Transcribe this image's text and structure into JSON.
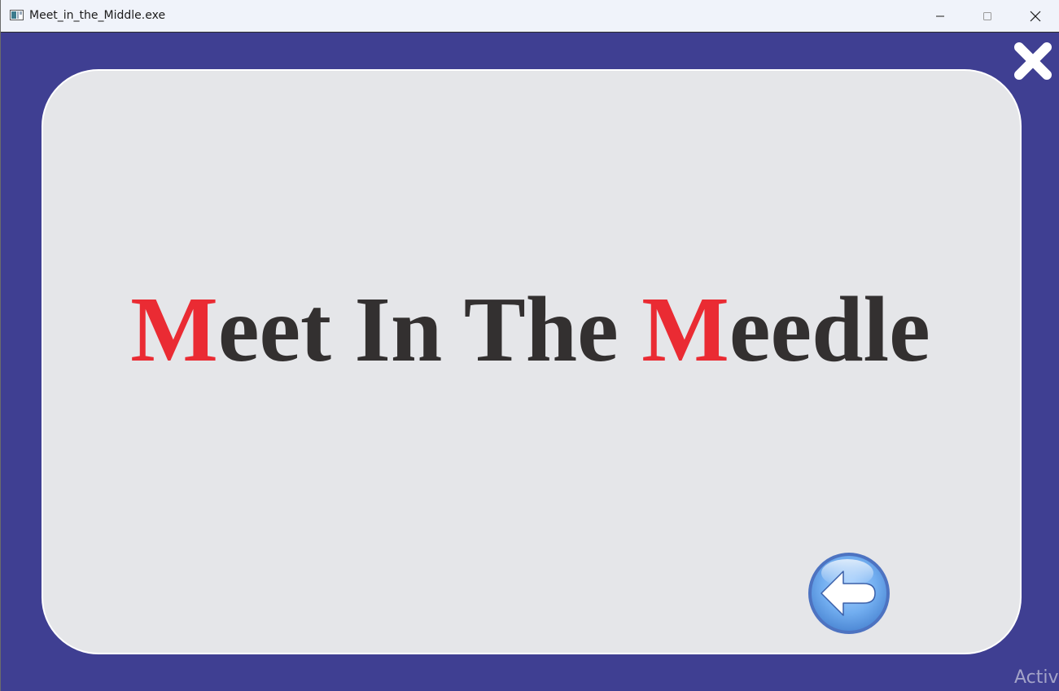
{
  "window": {
    "title": "Meet_in_the_Middle.exe",
    "controls": {
      "minimize_icon": "minimize-icon",
      "maximize_icon": "maximize-icon",
      "close_icon": "close-icon"
    }
  },
  "game": {
    "close_icon": "close-x-icon",
    "title_parts": {
      "word1_initial": "M",
      "word1_rest": "eet",
      "word2": "In",
      "word3": "The",
      "word4_initial": "M",
      "word4_rest": "eedle"
    },
    "back_button_icon": "arrow-left-icon"
  },
  "colors": {
    "background": "#3f3f92",
    "card": "#e5e6e9",
    "title_text": "#333030",
    "title_accent": "#ea2b33",
    "back_button": "#6fa8ef"
  },
  "watermark": {
    "text": "Activ"
  }
}
